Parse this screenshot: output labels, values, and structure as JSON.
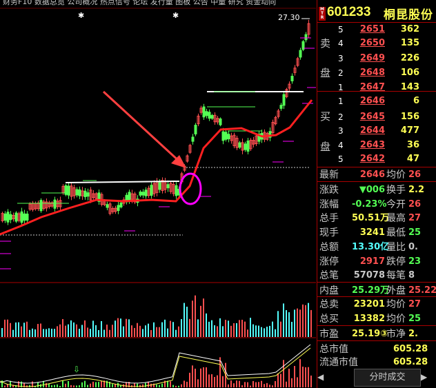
{
  "top_menu": "财务F10   数据总览   公司概况   热点信号   论坛 发行量   图板 公告   中量 研究   资金动向",
  "chart": {
    "price_high_label": "27.30",
    "colors": {
      "up": "#ff5050",
      "down": "#54ff54",
      "ma": "#ff2020",
      "accent": "#ff00ff",
      "arrow": "#ff4040",
      "white": "#ffffff",
      "yellow": "#ffff54"
    }
  },
  "stock": {
    "mtr_badge": "M T R",
    "code": "601233",
    "name": "桐昆股份"
  },
  "orderbook": {
    "sell_side_label": [
      "卖",
      "盘"
    ],
    "buy_side_label": [
      "买",
      "盘"
    ],
    "sell": [
      {
        "level": "5",
        "price": "2651",
        "volume": "362"
      },
      {
        "level": "4",
        "price": "2650",
        "volume": "135"
      },
      {
        "level": "3",
        "price": "2649",
        "volume": "226"
      },
      {
        "level": "2",
        "price": "2648",
        "volume": "106"
      },
      {
        "level": "1",
        "price": "2647",
        "volume": "143"
      }
    ],
    "buy": [
      {
        "level": "1",
        "price": "2646",
        "volume": "6"
      },
      {
        "level": "2",
        "price": "2645",
        "volume": "156"
      },
      {
        "level": "3",
        "price": "2644",
        "volume": "477"
      },
      {
        "level": "4",
        "price": "2643",
        "volume": "36"
      },
      {
        "level": "5",
        "price": "2642",
        "volume": "47"
      }
    ]
  },
  "quote": {
    "rows": [
      {
        "l1": "最新",
        "v1": "2646",
        "c1": "#ff5050",
        "l2": "均价",
        "v2": "26",
        "c2": "#ff5050"
      },
      {
        "l1": "涨跌",
        "v1": "▼006",
        "c1": "#54ff54",
        "l2": "换手",
        "v2": "2.2",
        "c2": "#ffff54"
      },
      {
        "l1": "涨幅",
        "v1": "-0.23%",
        "c1": "#54ff54",
        "l2": "今开",
        "v2": "26",
        "c2": "#ff5050"
      },
      {
        "l1": "总手",
        "v1": "50.51万",
        "c1": "#ffff54",
        "l2": "最高",
        "v2": "27",
        "c2": "#ff5050"
      },
      {
        "l1": "现手",
        "v1": "3241",
        "c1": "#ffff54",
        "l2": "最低",
        "v2": "25",
        "c2": "#54ff54"
      },
      {
        "l1": "总额",
        "v1": "13.30亿",
        "c1": "#54ffff",
        "l2": "量比",
        "v2": "0.",
        "c2": "#c8c8c8"
      },
      {
        "l1": "涨停",
        "v1": "2917",
        "c1": "#ff5050",
        "l2": "跌停",
        "v2": "23",
        "c2": "#54ff54"
      },
      {
        "l1": "总笔",
        "v1": "57078",
        "c1": "#c8c8c8",
        "l2": "每笔",
        "v2": "8",
        "c2": "#c8c8c8"
      },
      {
        "l1": "内盘",
        "v1": "25.29万",
        "c1": "#54ff54",
        "l2": "外盘",
        "v2": "25.22",
        "c2": "#ff5050"
      },
      {
        "l1": "总卖",
        "v1": "23201",
        "c1": "#ffff54",
        "l2": "均价",
        "v2": "27",
        "c2": "#ff5050"
      },
      {
        "l1": "总买",
        "v1": "13382",
        "c1": "#ffff54",
        "l2": "均价",
        "v2": "25",
        "c2": "#54ff54"
      },
      {
        "l1": "市盈",
        "v1": "25.19③",
        "c1": "#ffff54",
        "l2": "市净",
        "v2": "2.",
        "c2": "#ffff54"
      },
      {
        "l1": "总市值",
        "v1": "",
        "c1": "#ffff54",
        "l2": "",
        "v2": "605.28",
        "c2": "#ffff54"
      },
      {
        "l1": "流通市值",
        "v1": "",
        "c1": "#ffff54",
        "l2": "",
        "v2": "605.28",
        "c2": "#ffff54"
      }
    ]
  },
  "bottom_tab": {
    "label": "分时成交",
    "prev_icon": "◀",
    "next_icon": "▶"
  }
}
